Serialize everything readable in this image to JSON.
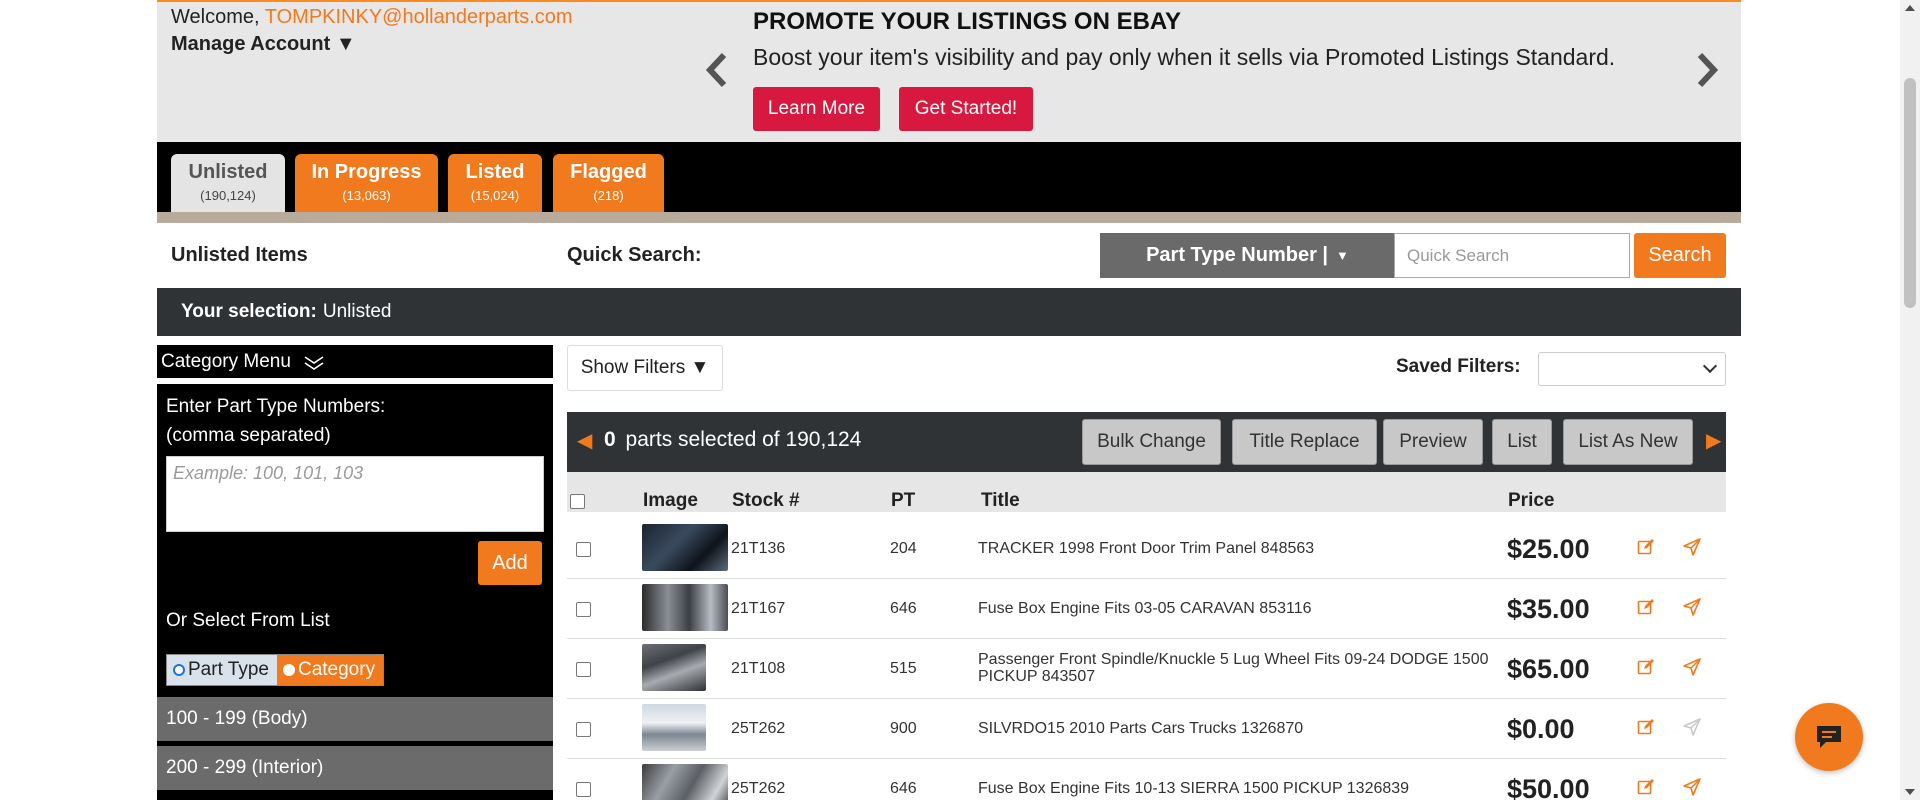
{
  "header": {
    "welcome_prefix": "Welcome,",
    "email": "TOMPKINKY@hollanderparts.com",
    "manage_account": "Manage Account ▼"
  },
  "promo": {
    "title": "PROMOTE YOUR LISTINGS ON EBAY",
    "subtitle": "Boost your item's visibility and pay only when it sells via Promoted Listings Standard.",
    "learn_more": "Learn More",
    "get_started": "Get Started!"
  },
  "tabs": [
    {
      "label": "Unlisted",
      "count": "(190,124)"
    },
    {
      "label": "In Progress",
      "count": "(13,063)"
    },
    {
      "label": "Listed",
      "count": "(15,024)"
    },
    {
      "label": "Flagged",
      "count": "(218)"
    }
  ],
  "search_row": {
    "section_title": "Unlisted Items",
    "quick_search_label": "Quick Search:",
    "type_select": "Part Type Number |",
    "placeholder": "Quick Search",
    "search_button": "Search"
  },
  "selection": {
    "label": "Your selection:",
    "value": "Unlisted"
  },
  "sidebar": {
    "category_menu": "Category Menu",
    "enter_label_1": "Enter Part Type Numbers:",
    "enter_label_2": "(comma separated)",
    "textarea_placeholder": "Example: 100, 101, 103",
    "add_button": "Add",
    "or_select": "Or Select From List",
    "radio_part_type": "Part Type",
    "radio_category": "Category",
    "ranges": [
      "100 - 199 (Body)",
      "200 - 299 (Interior)"
    ]
  },
  "filters": {
    "show_filters": "Show Filters ▼",
    "saved_filters_label": "Saved Filters:"
  },
  "action_bar": {
    "selected_count": "0",
    "selected_text": "parts selected of 190,124",
    "buttons": [
      "Bulk Change",
      "Title Replace",
      "Preview",
      "List",
      "List As New"
    ]
  },
  "table": {
    "headers": {
      "image": "Image",
      "stock": "Stock #",
      "pt": "PT",
      "title": "Title",
      "price": "Price"
    },
    "rows": [
      {
        "stock": "21T136",
        "pt": "204",
        "title": "TRACKER 1998 Front Door Trim Panel 848563",
        "price": "$25.00"
      },
      {
        "stock": "21T167",
        "pt": "646",
        "title": "Fuse Box Engine Fits 03-05 CARAVAN 853116",
        "price": "$35.00"
      },
      {
        "stock": "21T108",
        "pt": "515",
        "title": "Passenger Front Spindle/Knuckle 5 Lug Wheel Fits 09-24 DODGE 1500 PICKUP 843507",
        "price": "$65.00"
      },
      {
        "stock": "25T262",
        "pt": "900",
        "title": "SILVRDO15 2010 Parts Cars Trucks 1326870",
        "price": "$0.00"
      },
      {
        "stock": "25T262",
        "pt": "646",
        "title": "Fuse Box Engine Fits 10-13 SIERRA 1500 PICKUP 1326839",
        "price": "$50.00"
      }
    ]
  },
  "colors": {
    "accent": "#f27a1e",
    "promo_button": "#d7183f",
    "dark_bar": "#2f3336"
  },
  "icons": [
    "chevron-left-icon",
    "chevron-right-icon",
    "double-chevron-down-icon",
    "edit-icon",
    "send-icon",
    "chat-icon"
  ]
}
